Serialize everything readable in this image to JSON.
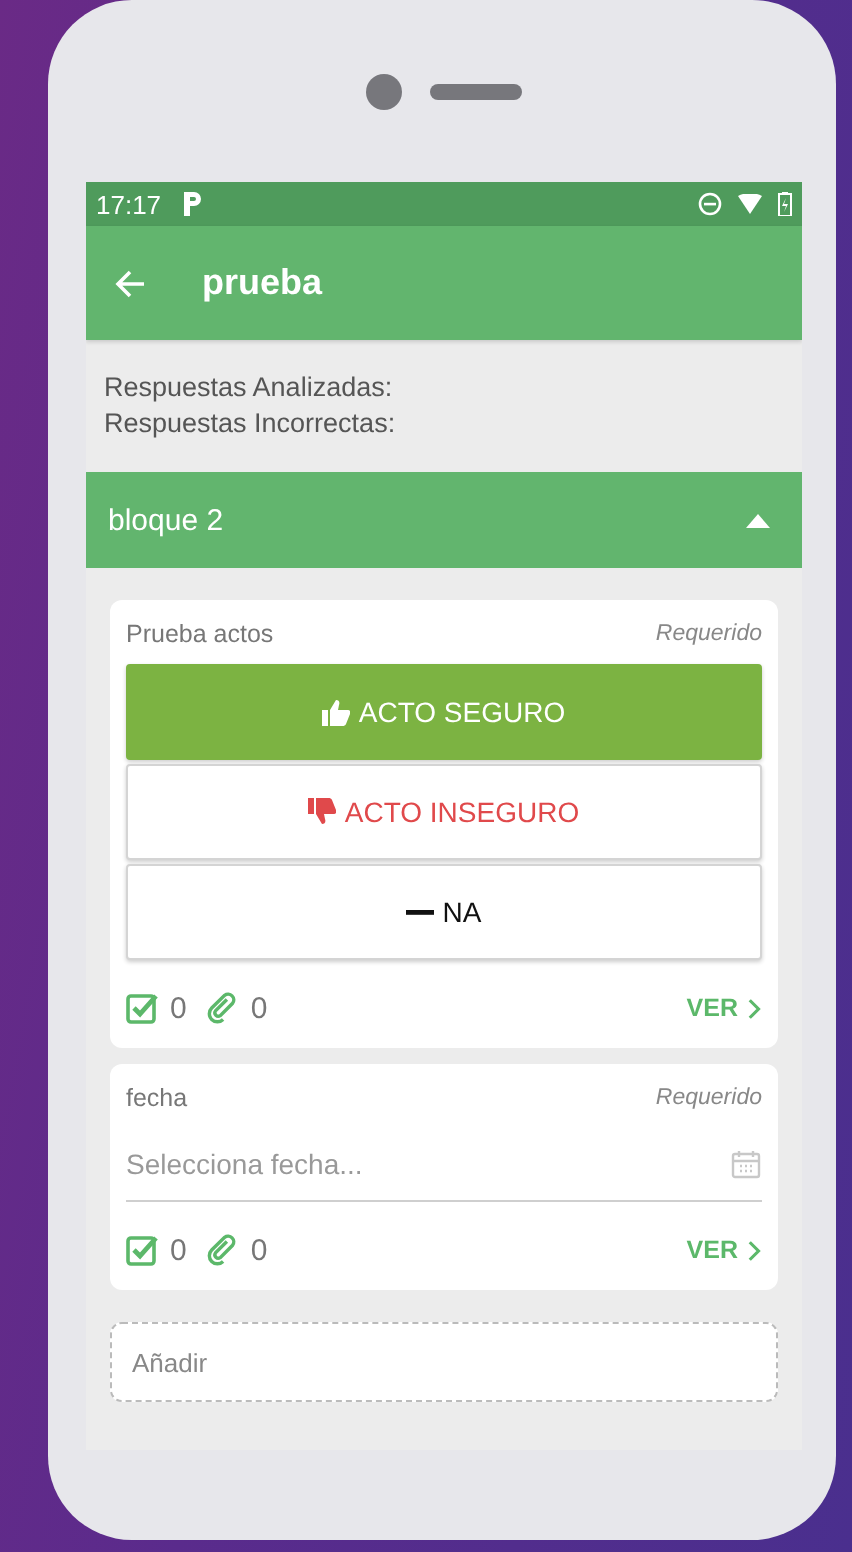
{
  "status_bar": {
    "time": "17:17"
  },
  "app_bar": {
    "title": "prueba"
  },
  "summary": [
    "Respuestas Analizadas:",
    "Respuestas Incorrectas:"
  ],
  "section": {
    "title": "bloque 2",
    "expanded": true
  },
  "questions": [
    {
      "kind": "options",
      "label": "Prueba actos",
      "required": "Requerido",
      "options": [
        {
          "label": "ACTO SEGURO",
          "kind": "positive",
          "color": "#7cb342",
          "selected": true
        },
        {
          "label": "ACTO INSEGURO",
          "kind": "negative",
          "color": "#e0494b",
          "selected": false
        },
        {
          "label": "NA",
          "kind": "neutral",
          "color": "#111111",
          "selected": false
        }
      ],
      "checks": "0",
      "attachments": "0",
      "more": "VER"
    },
    {
      "kind": "date",
      "label": "fecha",
      "required": "Requerido",
      "placeholder": "Selecciona fecha...",
      "checks": "0",
      "attachments": "0",
      "more": "VER"
    }
  ],
  "add": {
    "placeholder": "Añadir"
  }
}
